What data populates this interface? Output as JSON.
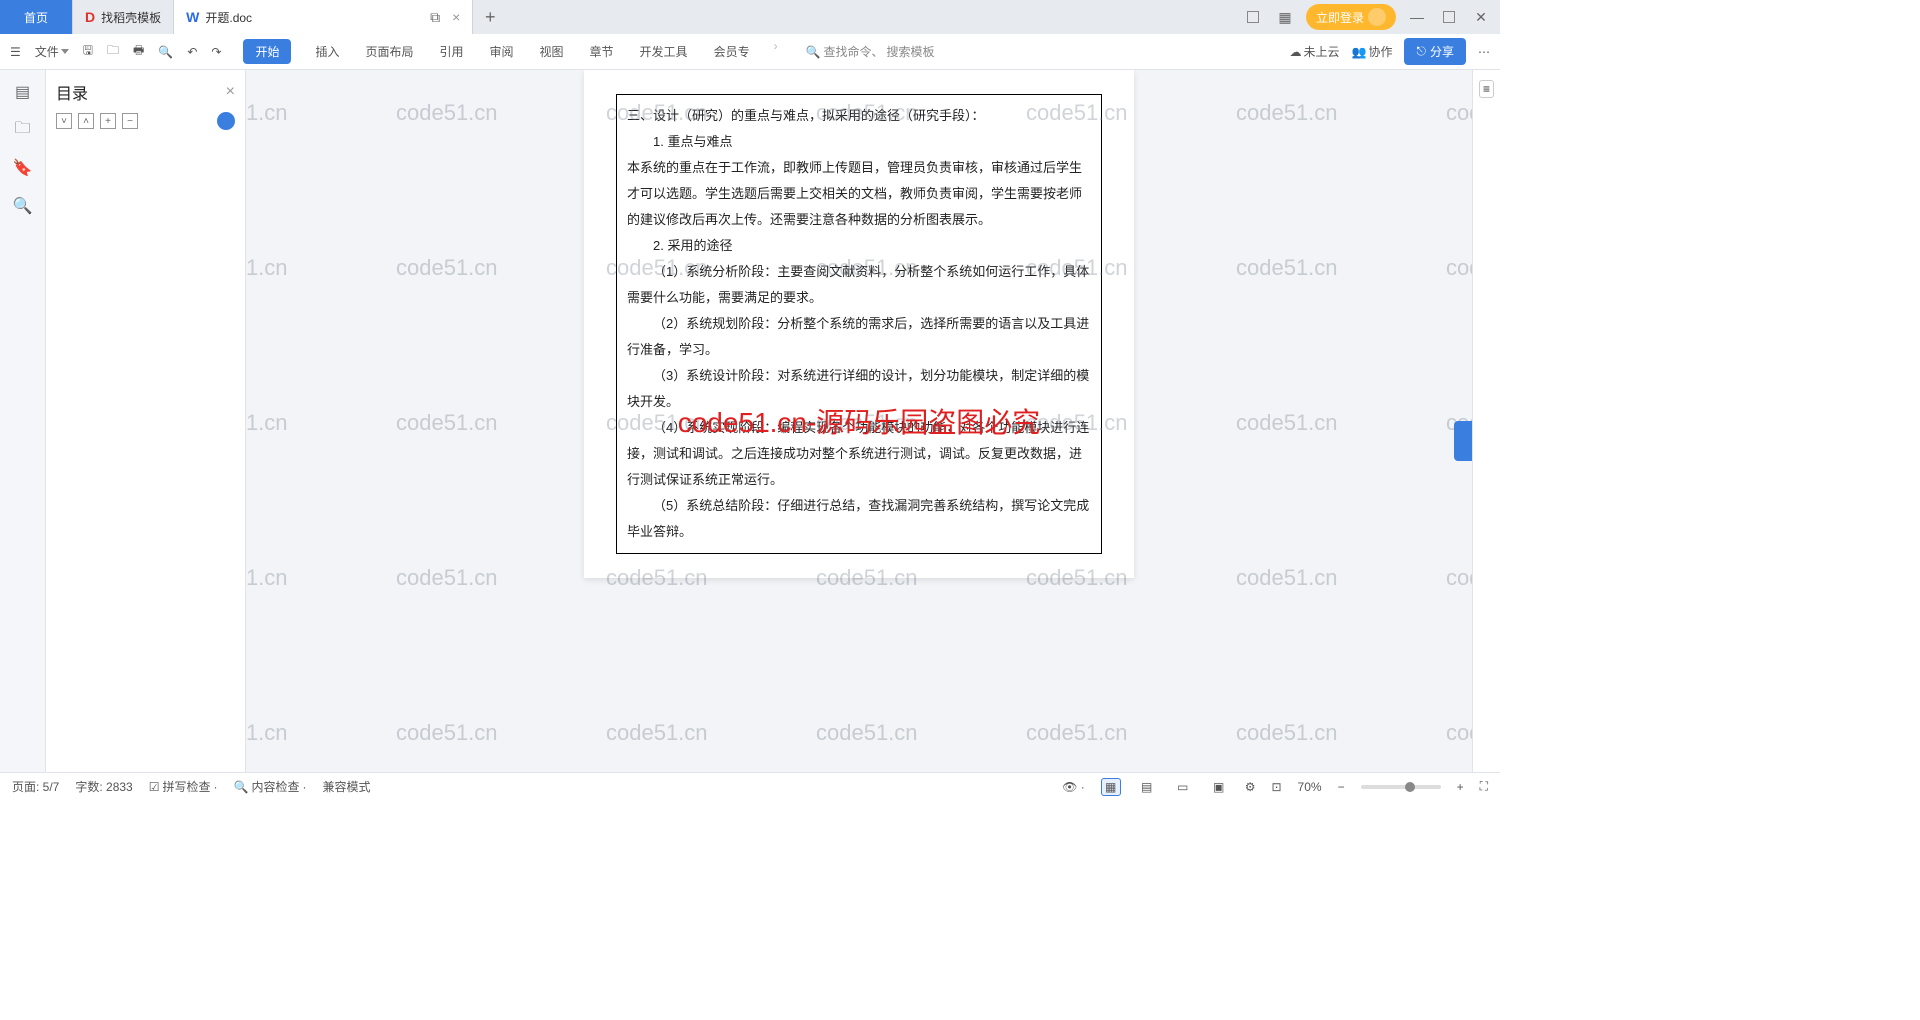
{
  "tabs": {
    "home": "首页",
    "template": "找稻壳模板",
    "doc": "开题.doc"
  },
  "login_btn": "立即登录",
  "toolbar": {
    "file": "文件"
  },
  "menu": {
    "start": "开始",
    "insert": "插入",
    "layout": "页面布局",
    "ref": "引用",
    "review": "审阅",
    "view": "视图",
    "chapter": "章节",
    "dev": "开发工具",
    "member": "会员专"
  },
  "search": {
    "cmd": "查找命令、",
    "tpl": "搜索模板"
  },
  "right": {
    "cloud": "未上云",
    "collab": "协作",
    "share": "分享"
  },
  "outline": {
    "title": "目录"
  },
  "doc": {
    "h": "三、设计（研究）的重点与难点，拟采用的途径（研究手段）：",
    "p1": "1. 重点与难点",
    "p2": "本系统的重点在于工作流，即教师上传题目，管理员负责审核，审核通过后学生才可以选题。学生选题后需要上交相关的文档，教师负责审阅，学生需要按老师的建议修改后再次上传。还需要注意各种数据的分析图表展示。",
    "p3": "2. 采用的途径",
    "p4": "（1）系统分析阶段：主要查阅文献资料，分析整个系统如何运行工作，具体需要什么功能，需要满足的要求。",
    "p5": "（2）系统规划阶段：分析整个系统的需求后，选择所需要的语言以及工具进行准备，学习。",
    "p6": "（3）系统设计阶段：对系统进行详细的设计，划分功能模块，制定详细的模块开发。",
    "p7": "（4）系统实现阶段：编程实现各个功能模块的功能，对各个功能模块进行连接，测试和调试。之后连接成功对整个系统进行测试，调试。反复更改数据，进行测试保证系统正常运行。",
    "p8": "（5）系统总结阶段：仔细进行总结，查找漏洞完善系统结构，撰写论文完成毕业答辩。"
  },
  "watermark": "code51.cn",
  "watermark_red": "code51.cn-源码乐园盗图必究",
  "status": {
    "page": "页面: 5/7",
    "words": "字数: 2833",
    "spell": "拼写检查",
    "content": "内容检查",
    "compat": "兼容模式",
    "zoom": "70%"
  }
}
